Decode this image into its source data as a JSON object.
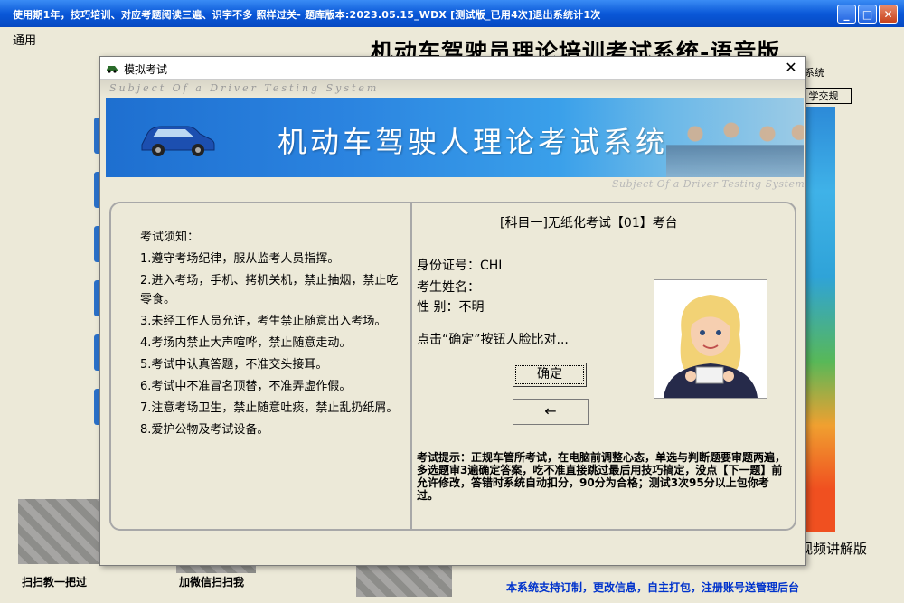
{
  "window": {
    "title": "使用期1年，技巧培训、对应考题阅读三遍、识字不多 照样过关- 题库版本:2023.05.15_WDX [测试版_已用4次]退出系统计1次",
    "minimize": "_",
    "maximize": "□",
    "close": "✕"
  },
  "main": {
    "menu": "通用",
    "heading": "机动车驾驶员理论培训考试系统-语音版",
    "subtext": "系统",
    "right_button": "学交规",
    "bottom_right": "视频讲解版",
    "footer": "本系统支持订制，更改信息，自主打包，注册账号送管理后台",
    "qr1_label": "扫扫教一把过",
    "qr2_label": "加微信扫扫我"
  },
  "dialog": {
    "title": "模拟考试",
    "close": "✕",
    "watermark_top": "Subject Of a Driver Testing System",
    "banner_title": "机动车驾驶人理论考试系统",
    "watermark_bottom": "Subject Of a Driver Testing System",
    "notice": [
      "考试须知：",
      "1.遵守考场纪律，服从监考人员指挥。",
      "2.进入考场，手机、拷机关机，禁止抽烟，禁止吃零食。",
      "3.未经工作人员允许，考生禁止随意出入考场。",
      "4.考场内禁止大声喧哗，禁止随意走动。",
      "5.考试中认真答题，不准交头接耳。",
      "6.考试中不准冒名顶替，不准弄虚作假。",
      "7.注意考场卫生，禁止随意吐痰，禁止乱扔纸屑。",
      "8.爱护公物及考试设备。"
    ],
    "exam_title": "[科目一]无纸化考试【01】考台",
    "id_label": "身份证号：CHI",
    "name_label": "考生姓名：",
    "gender_label": "性    别：不明",
    "prompt": "点击“确定”按钮人脸比对...",
    "confirm_button": "确定",
    "back_button": "←",
    "tip": "考试提示：正规车管所考试，在电脑前调整心态，单选与判断题要审题两遍，多选题审3遍确定答案，吃不准直接跳过最后用技巧搞定，没点【下一题】前允许修改，答错时系统自动扣分，90分为合格；测试3次95分以上包你考过。"
  }
}
